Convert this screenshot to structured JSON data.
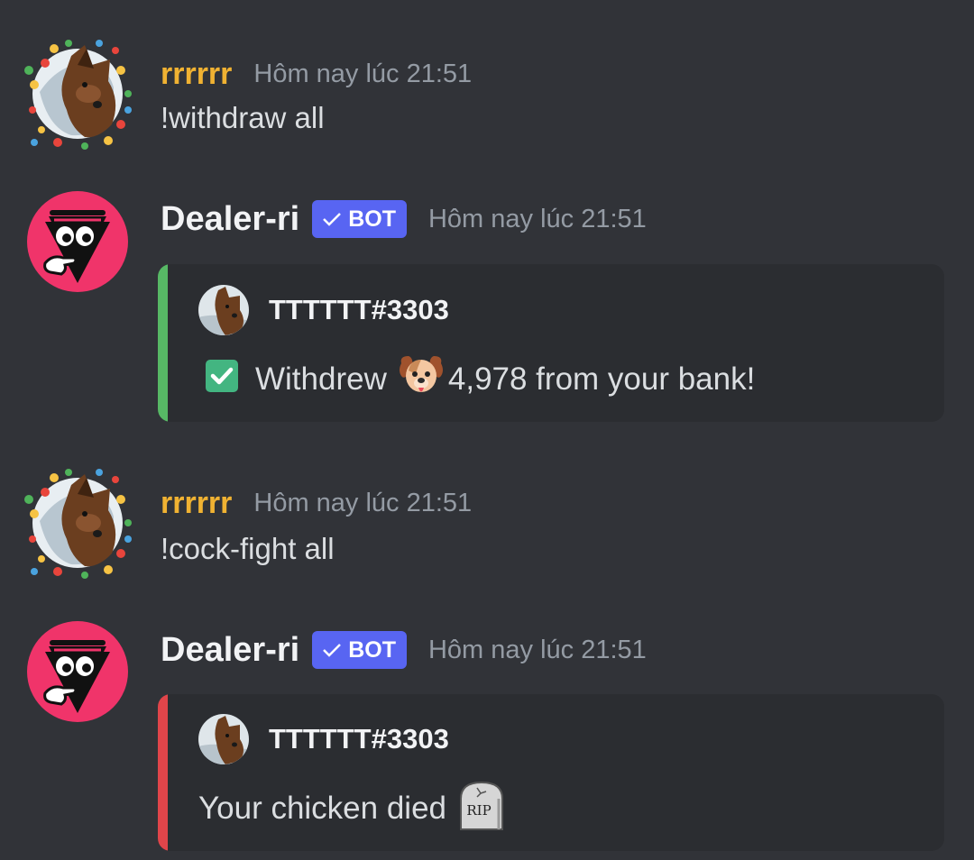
{
  "colors": {
    "background": "#313338",
    "user_name": "#f0b232",
    "bot_tag": "#5865f2",
    "embed_bg": "#2b2d31",
    "embed_success_bar": "#57b865",
    "embed_fail_bar": "#e0454a"
  },
  "messages": [
    {
      "author": "rrrrrr",
      "timestamp": "Hôm nay lúc 21:51",
      "content": "!withdraw all"
    },
    {
      "author": "Dealer-ri",
      "bot_tag": "BOT",
      "timestamp": "Hôm nay lúc 21:51",
      "embed": {
        "author": "TTTTTT#3303",
        "icon_lead": "check-mark-emoji",
        "text_before": "Withdrew",
        "currency_icon": "dog-emoji",
        "text_after": "4,978 from your bank!"
      }
    },
    {
      "author": "rrrrrr",
      "timestamp": "Hôm nay lúc 21:51",
      "content": "!cock-fight all"
    },
    {
      "author": "Dealer-ri",
      "bot_tag": "BOT",
      "timestamp": "Hôm nay lúc 21:51",
      "embed": {
        "author": "TTTTTT#3303",
        "text": "Your chicken died",
        "tombstone_text": "RIP",
        "icon_trail": "tombstone-emoji"
      }
    }
  ]
}
